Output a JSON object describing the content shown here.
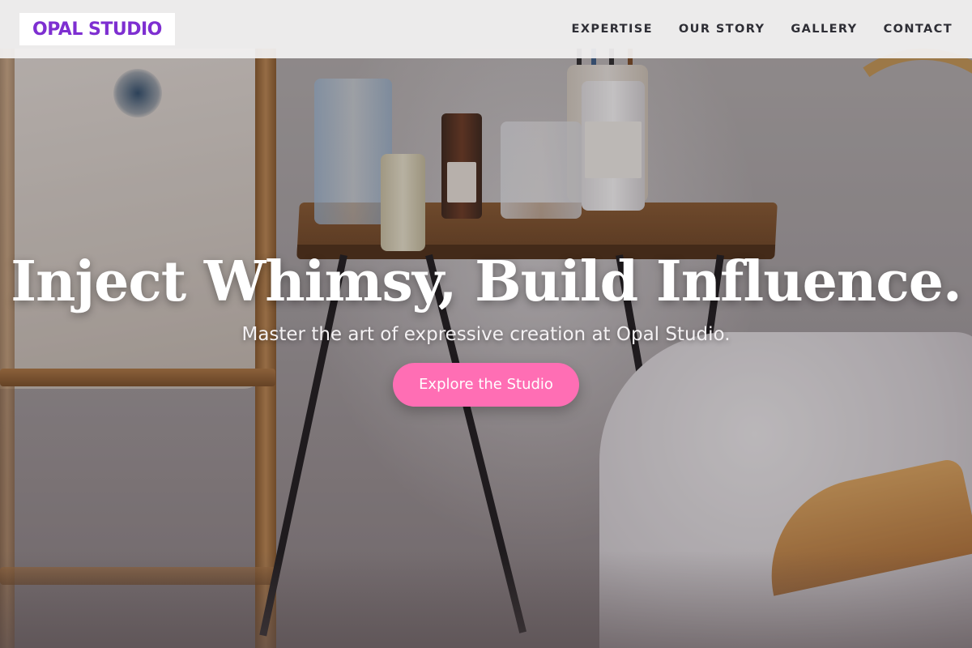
{
  "brand": {
    "name": "OPAL STUDIO",
    "color": "#7e2fd1"
  },
  "nav": {
    "items": [
      {
        "label": "EXPERTISE"
      },
      {
        "label": "OUR STORY"
      },
      {
        "label": "GALLERY"
      },
      {
        "label": "CONTACT"
      }
    ]
  },
  "hero": {
    "headline": "Inject Whimsy, Build Influence.",
    "subheadline": "Master the art of expressive creation at Opal Studio.",
    "cta_label": "Explore the Studio",
    "cta_color": "#ff6eb4"
  }
}
